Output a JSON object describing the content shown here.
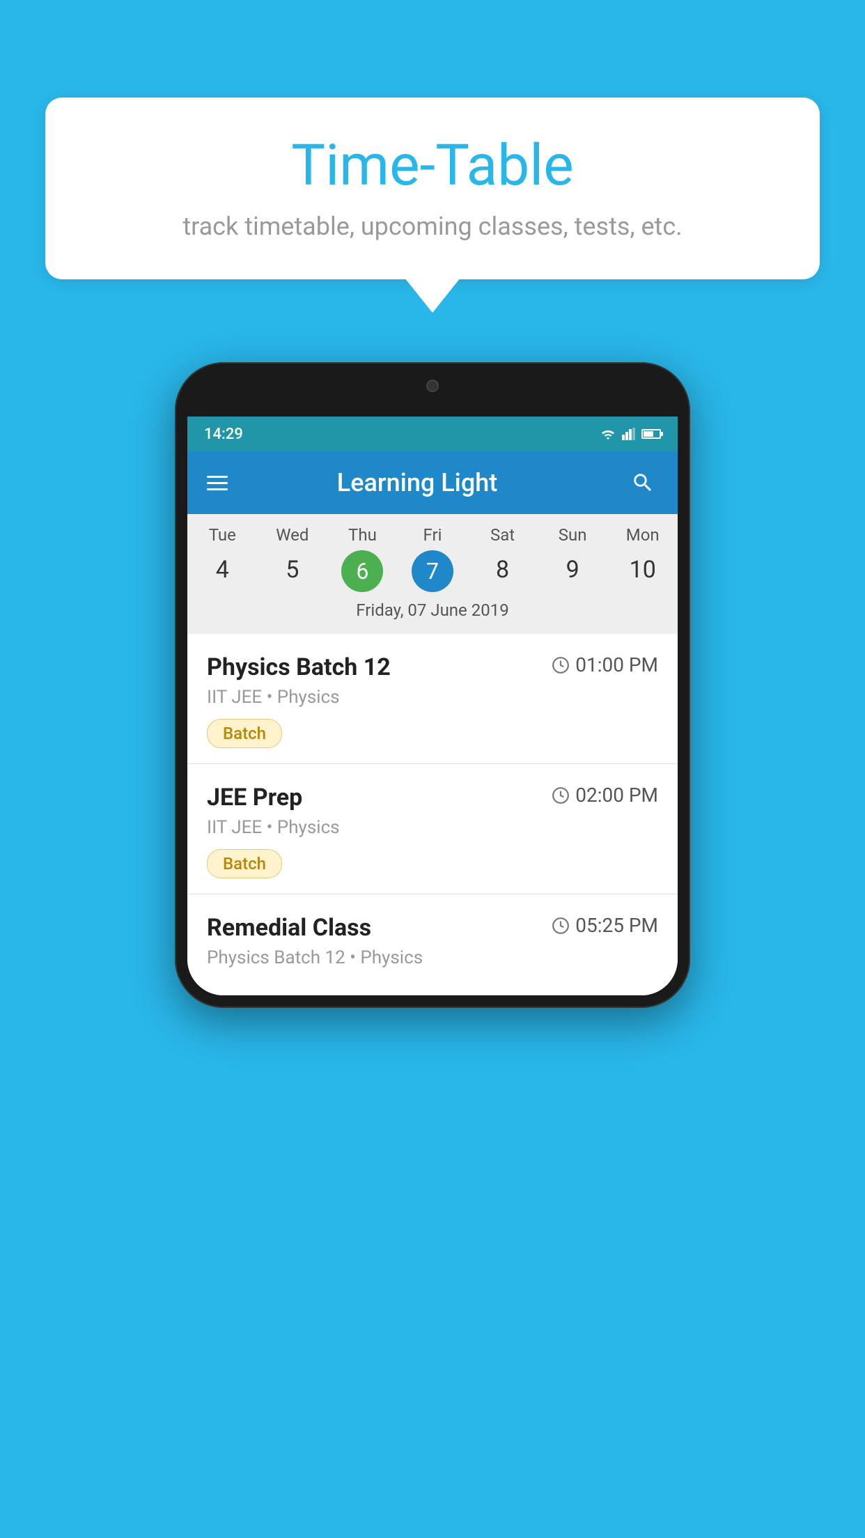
{
  "page": {
    "background_color": "#29b6e8"
  },
  "speech_bubble": {
    "title": "Time-Table",
    "subtitle": "track timetable, upcoming classes, tests, etc."
  },
  "status_bar": {
    "time": "14:29"
  },
  "app_bar": {
    "title": "Learning Light"
  },
  "calendar": {
    "selected_date_label": "Friday, 07 June 2019",
    "days": [
      {
        "name": "Tue",
        "num": "4",
        "state": "normal"
      },
      {
        "name": "Wed",
        "num": "5",
        "state": "normal"
      },
      {
        "name": "Thu",
        "num": "6",
        "state": "today"
      },
      {
        "name": "Fri",
        "num": "7",
        "state": "selected"
      },
      {
        "name": "Sat",
        "num": "8",
        "state": "normal"
      },
      {
        "name": "Sun",
        "num": "9",
        "state": "normal"
      },
      {
        "name": "Mon",
        "num": "10",
        "state": "normal"
      }
    ]
  },
  "schedule": {
    "items": [
      {
        "name": "Physics Batch 12",
        "time": "01:00 PM",
        "meta": "IIT JEE • Physics",
        "badge": "Batch"
      },
      {
        "name": "JEE Prep",
        "time": "02:00 PM",
        "meta": "IIT JEE • Physics",
        "badge": "Batch"
      },
      {
        "name": "Remedial Class",
        "time": "05:25 PM",
        "meta": "Physics Batch 12 • Physics",
        "badge": ""
      }
    ]
  },
  "icons": {
    "hamburger": "☰",
    "search": "🔍",
    "clock": "🕐"
  }
}
